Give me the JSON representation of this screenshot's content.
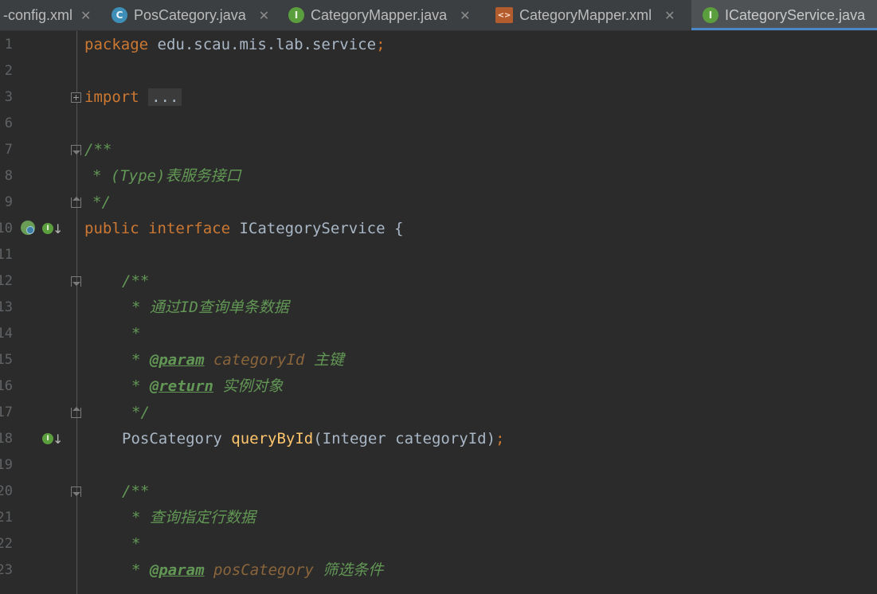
{
  "tabs": [
    {
      "label": "-config.xml",
      "icon": "none",
      "active": false
    },
    {
      "label": "PosCategory.java",
      "icon": "class-icon",
      "active": false
    },
    {
      "label": "CategoryMapper.java",
      "icon": "interface-icon",
      "active": false
    },
    {
      "label": "CategoryMapper.xml",
      "icon": "xml-file-icon",
      "active": false
    },
    {
      "label": "ICategoryService.java",
      "icon": "interface-icon",
      "active": true
    }
  ],
  "tab_close_glyph": "✕",
  "icon_letters": {
    "class": "C",
    "interface": "I",
    "xml": "<>"
  },
  "editor": {
    "line_numbers": [
      "1",
      "2",
      "3",
      "6",
      "7",
      "8",
      "9",
      "10",
      "11",
      "12",
      "13",
      "14",
      "15",
      "16",
      "17",
      "18",
      "19",
      "20",
      "21",
      "22",
      "23"
    ],
    "code": {
      "l1": {
        "kw": "package",
        "rest": " edu.scau.mis.lab.service",
        "semi": ";"
      },
      "l3": {
        "kw": "import",
        "folded": "..."
      },
      "l7": "/**",
      "l8": "* (Type)表服务接口",
      "l9": "*/",
      "l10": {
        "kw1": "public",
        "kw2": "interface",
        "rest": " ICategoryService {"
      },
      "l12": "/**",
      "l13": "* 通过ID查询单条数据",
      "l14": "*",
      "l15": {
        "star": "* ",
        "tag": "@param",
        "param": "categoryId",
        "desc": "主键"
      },
      "l16": {
        "star": "* ",
        "tag": "@return",
        "desc": "实例对象"
      },
      "l17": "*/",
      "l18": {
        "type": "PosCategory ",
        "fn": "queryById",
        "args": "(Integer categoryId)",
        "semi": ";"
      },
      "l20": "/**",
      "l21": "* 查询指定行数据",
      "l22": "*",
      "l23": {
        "star": "* ",
        "tag": "@param",
        "param": "posCategory",
        "desc": "筛选条件"
      }
    }
  },
  "colors": {
    "background": "#2b2b2b",
    "keyword": "#cc7832",
    "comment": "#629755",
    "function": "#ffc66d",
    "param": "#8a653b",
    "text": "#a9b7c6",
    "tab_active_underline": "#4a88c7"
  }
}
